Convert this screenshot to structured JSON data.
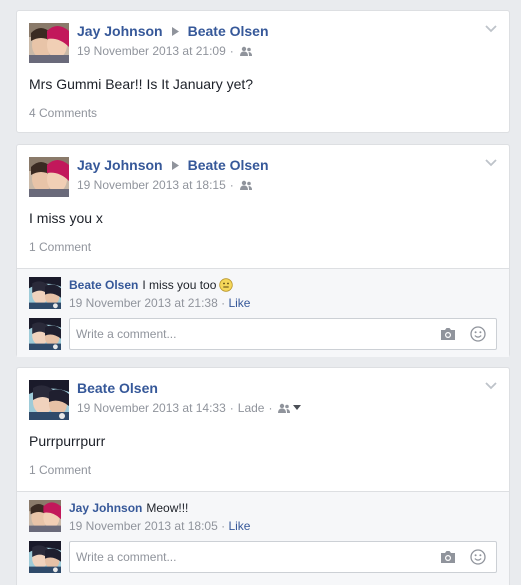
{
  "posts": [
    {
      "author": "Jay Johnson",
      "target": "Beate Olsen",
      "timestamp": "19 November 2013 at 21:09",
      "privacy_icon": "friends-icon",
      "text": "Mrs Gummi Bear!! Is It January yet?",
      "comment_count": "4 Comments"
    },
    {
      "author": "Jay Johnson",
      "target": "Beate Olsen",
      "timestamp": "19 November 2013 at 18:15",
      "privacy_icon": "friends-icon",
      "text": "I miss you x",
      "comment_count": "1 Comment",
      "comments": [
        {
          "author": "Beate Olsen",
          "text": "I miss you too",
          "emoji": "smiley-icon",
          "timestamp": "19 November 2013 at 21:38",
          "like_label": "Like"
        }
      ],
      "write_placeholder": "Write a comment..."
    },
    {
      "author": "Beate Olsen",
      "timestamp": "19 November 2013 at 14:33",
      "action_label": "Lade",
      "privacy_icon": "friends-icon",
      "text": "Purrpurrpurr",
      "comment_count": "1 Comment",
      "comments": [
        {
          "author": "Jay Johnson",
          "text": "Meow!!!",
          "timestamp": "19 November 2013 at 18:05",
          "like_label": "Like"
        }
      ],
      "write_placeholder": "Write a comment..."
    }
  ],
  "sep": "·",
  "colors": {
    "link": "#365899",
    "meta": "#90949c",
    "background": "#e9ebee",
    "comments_bg": "#f6f7f9"
  }
}
